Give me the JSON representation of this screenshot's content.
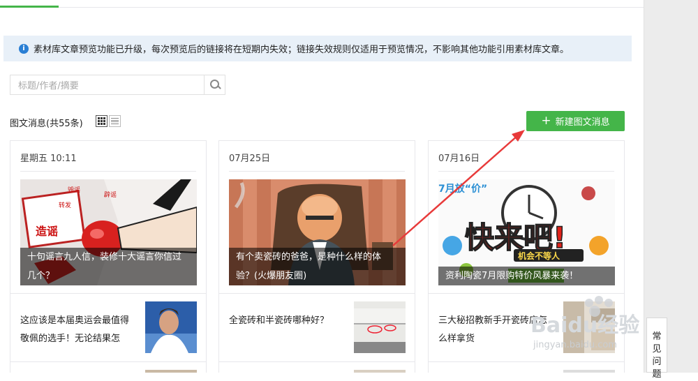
{
  "notice": {
    "text": "素材库文章预览功能已升级，每次预览后的链接将在短期内失效；链接失效规则仅适用于预览情况，不影响其他功能引用素材库文章。"
  },
  "search": {
    "placeholder": "标题/作者/摘要"
  },
  "list_header": {
    "count_label": "图文消息(共55条)"
  },
  "new_button": {
    "label": "新建图文消息"
  },
  "cards": [
    {
      "date": "星期五 10:11",
      "caption": "十句谣言九人信，装修十大谣言你信过几个？",
      "subtitle": "这应该是本届奥运会最值得敬佩的选手！无论结果怎",
      "cover_text": [
        "造谣",
        "转发",
        "毁谣",
        "辟谣"
      ]
    },
    {
      "date": "07月25日",
      "caption": "有个卖瓷砖的爸爸，是种什么样的体验？(火爆朋友圈)",
      "subtitle": "全瓷砖和半瓷砖哪种好？"
    },
    {
      "date": "07月16日",
      "caption": "资利陶瓷7月限购特价风暴来袭！",
      "subtitle": "三大秘招教新手开瓷砖店怎么样拿货",
      "cover_text": [
        "快来吧!",
        "机会不等人",
        "7月放“价”"
      ]
    }
  ],
  "faq": {
    "label": "常见问题"
  },
  "watermark": {
    "text": "Baidu经验",
    "url_text": "jingyan.baidu.com"
  },
  "colors": {
    "accent": "#44b549",
    "annotation": "#e83a3a",
    "notice_bg": "#e8f0f8",
    "info_icon": "#2a7fd4"
  }
}
